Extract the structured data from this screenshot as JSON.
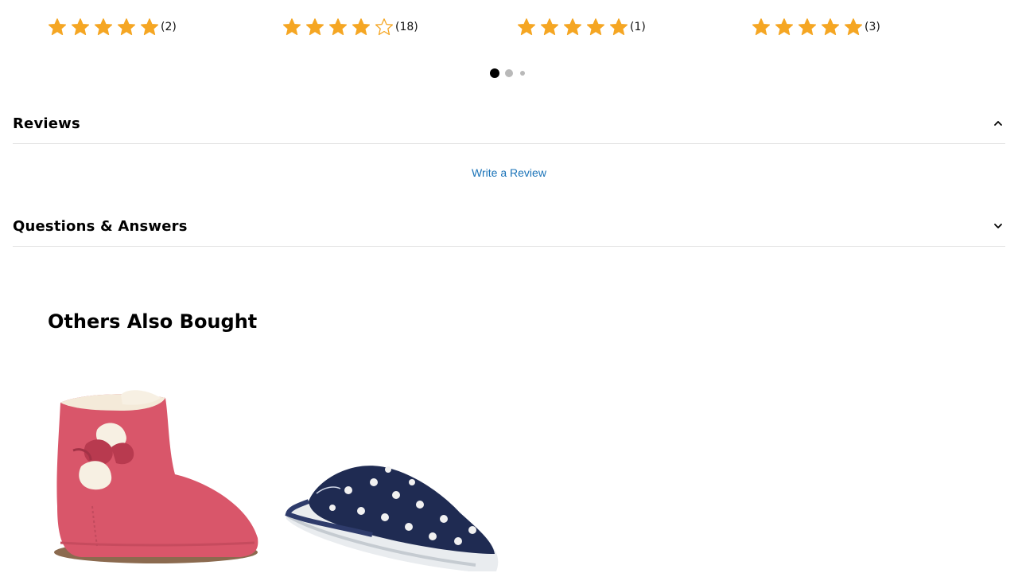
{
  "colors": {
    "star": "#f5a623",
    "link": "#1a73b8",
    "dot_active": "#000000",
    "dot_inactive": "#b9b9b9",
    "divider": "#e2e2e2"
  },
  "ratings": [
    {
      "rating": 5,
      "count": "(2)"
    },
    {
      "rating": 4,
      "count": "(18)"
    },
    {
      "rating": 5,
      "count": "(1)"
    },
    {
      "rating": 5,
      "count": "(3)"
    }
  ],
  "carousel": {
    "pages": 3,
    "active_index": 0
  },
  "reviews": {
    "title": "Reviews",
    "state": "expanded",
    "write_review_label": "Write a Review"
  },
  "questions": {
    "title": "Questions & Answers",
    "state": "collapsed"
  },
  "others_also_bought": {
    "title": "Others Also Bought",
    "products": [
      {
        "image": "pink-suede-boot-with-fur-bow"
      },
      {
        "image": "navy-floral-slipper"
      }
    ]
  }
}
